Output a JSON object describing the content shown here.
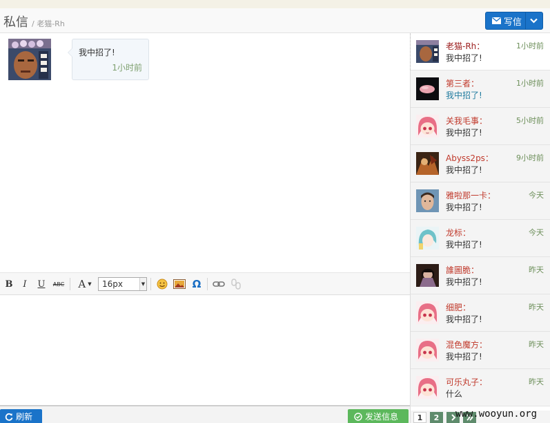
{
  "header": {
    "title": "私信",
    "subtitle": "/ 老猫-Rh",
    "write_label": "写信"
  },
  "conversation": {
    "messages": [
      {
        "text": "我中招了!",
        "time": "1小时前"
      }
    ]
  },
  "editor": {
    "toolbar": {
      "bold": "B",
      "italic": "I",
      "underline": "U",
      "strike": "ABC",
      "font_glyph": "A",
      "font_size": "16px",
      "special_char": "Ω"
    },
    "content": ""
  },
  "footer": {
    "refresh_label": "刷新",
    "send_label": "发送信息"
  },
  "sidebar": {
    "contacts": [
      {
        "name": "老猫-Rh：",
        "time": "1小时前",
        "message": "我中招了!"
      },
      {
        "name": "第三者：",
        "time": "1小时前",
        "message": "我中招了!"
      },
      {
        "name": "关我毛事：",
        "time": "5小时前",
        "message": "我中招了!"
      },
      {
        "name": "Abyss2ps：",
        "time": "9小时前",
        "message": "我中招了!"
      },
      {
        "name": "雅啦那一卡：",
        "time": "今天",
        "message": "我中招了!"
      },
      {
        "name": "龙标：",
        "time": "今天",
        "message": "我中招了!"
      },
      {
        "name": "誰圖脆：",
        "time": "昨天",
        "message": "我中招了!"
      },
      {
        "name": "细肥：",
        "time": "昨天",
        "message": "我中招了!"
      },
      {
        "name": "混色魔方：",
        "time": "昨天",
        "message": "我中招了!"
      },
      {
        "name": "可乐丸子：",
        "time": "昨天",
        "message": "什么"
      }
    ],
    "pagination": {
      "p1": "1",
      "p2": "2"
    }
  },
  "watermark": "www.wooyun.org",
  "colors": {
    "primary_button": "#1a73c9",
    "send_button": "#5cb85c",
    "contact_name": "#c0392b",
    "timestamp": "#6d8f5a",
    "pager_green": "#5e8b6c"
  }
}
